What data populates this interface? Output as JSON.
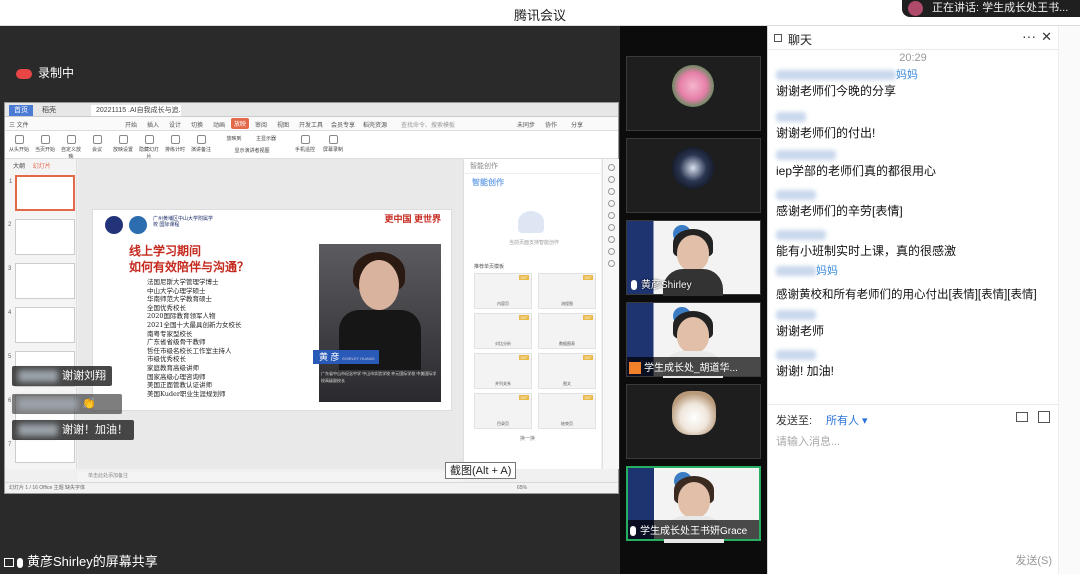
{
  "window": {
    "title": "腾讯会议"
  },
  "speaking": {
    "text": "正在讲话: 学生成长处王书..."
  },
  "recording": {
    "label": "录制中"
  },
  "share": {
    "label": "黄彦Shirley的屏幕共享"
  },
  "wps": {
    "tabs": [
      "首页",
      "稻壳",
      "20221115 .AI自我成长与追..."
    ],
    "menu": [
      "三 文件",
      "开始",
      "插入",
      "设计",
      "切换",
      "动画",
      "放映",
      "审阅",
      "视图",
      "开发工具",
      "会员专享",
      "稻壳资源",
      "查找命令、搜索模板",
      "未同步",
      "协作",
      "分享"
    ],
    "ribbon": [
      "从头开始",
      "当页开始",
      "自定义放映",
      "会议",
      "放映设置",
      "隐藏幻灯片",
      "排练计时",
      "演讲备注",
      "放映到",
      "主显示器",
      "显示演讲者视图",
      "手机遥控",
      "屏幕录制"
    ],
    "panel_tabs": [
      "大纲",
      "幻灯片"
    ],
    "notes": "单击此处添加备注",
    "status": "幻灯片 1 / 16   Office 主题   缺失字体",
    "zoom": "65%",
    "side_header": "智能创作",
    "side_ai": "智能创作",
    "side_hint": "当前页面支持智能创作",
    "side_section": "推荐单页模板",
    "side_cards": [
      "内容页",
      "流程图",
      "对比分析",
      "数据图表",
      "并列关系",
      "图文",
      "目录页",
      "结束页"
    ],
    "side_more": "换一换"
  },
  "slide": {
    "slogan": "更中国 更世界",
    "school": "广州黄埔区中山大学附属学校 国际课程",
    "title1": "线上学习期间",
    "title2": "如何有效陪伴与沟通？",
    "bio": [
      "法国尼斯大学管理学博士",
      "中山大学心理学硕士",
      "华南师范大学教育硕士",
      "全国优秀校长",
      "2020国际教育领军人物",
      "2021全国十大最具创新力女校长",
      "南粤专家型校长",
      "广东省省级骨干教师",
      "哲任市级名校长工作室主持人",
      "市级优秀校长",
      "家庭教育高级讲师",
      "国家高级心理咨询师",
      "美国正面管教认证讲师",
      "美国Kuder职业生涯规划师"
    ],
    "name": "黄 彦",
    "name_en": "SHIRLEY HUANG",
    "photo_bio": "广东省中山市纪念中学 中山市实验学校 仲元国际学校 中美国际学校高级副校长"
  },
  "danmu": [
    {
      "text": "谢谢刘翔"
    },
    {
      "text": "谢谢！加油！"
    }
  ],
  "tooltip": {
    "text": "截图(Alt + A)"
  },
  "tiles": [
    {
      "name": ""
    },
    {
      "name": ""
    },
    {
      "name": "黄彦Shirley"
    },
    {
      "name": "学生成长处_胡道华..."
    },
    {
      "name": ""
    },
    {
      "name": "学生成长处王书妍Grace"
    }
  ],
  "chat": {
    "title": "聊天",
    "time": "20:29",
    "messages": [
      {
        "from_suffix": "妈妈",
        "text": ""
      },
      {
        "from_suffix": "",
        "text": "谢谢老师们今晚的分享"
      },
      {
        "from_suffix": "",
        "text": "谢谢老师们的付出!"
      },
      {
        "from_suffix": "",
        "text": "iep学部的老师们真的都很用心"
      },
      {
        "from_suffix": "",
        "text": "感谢老师们的辛劳[表情]"
      },
      {
        "from_suffix": "",
        "text": "能有小班制实时上课，真的很感激"
      },
      {
        "from_suffix": "妈妈",
        "text": ""
      },
      {
        "from_suffix": "",
        "text": "感谢黄校和所有老师们的用心付出[表情][表情][表情]"
      },
      {
        "from_suffix": "",
        "text": "谢谢老师"
      },
      {
        "from_suffix": "",
        "text": "谢谢! 加油!"
      }
    ],
    "send_to_label": "发送至:",
    "send_to_value": "所有人",
    "placeholder": "请输入消息...",
    "send_button": "发送(S)"
  },
  "colors": {
    "accent": "#2b73d8",
    "slide_red": "#c52a1f",
    "record_red": "#e84545",
    "active_border": "#27ae60"
  }
}
